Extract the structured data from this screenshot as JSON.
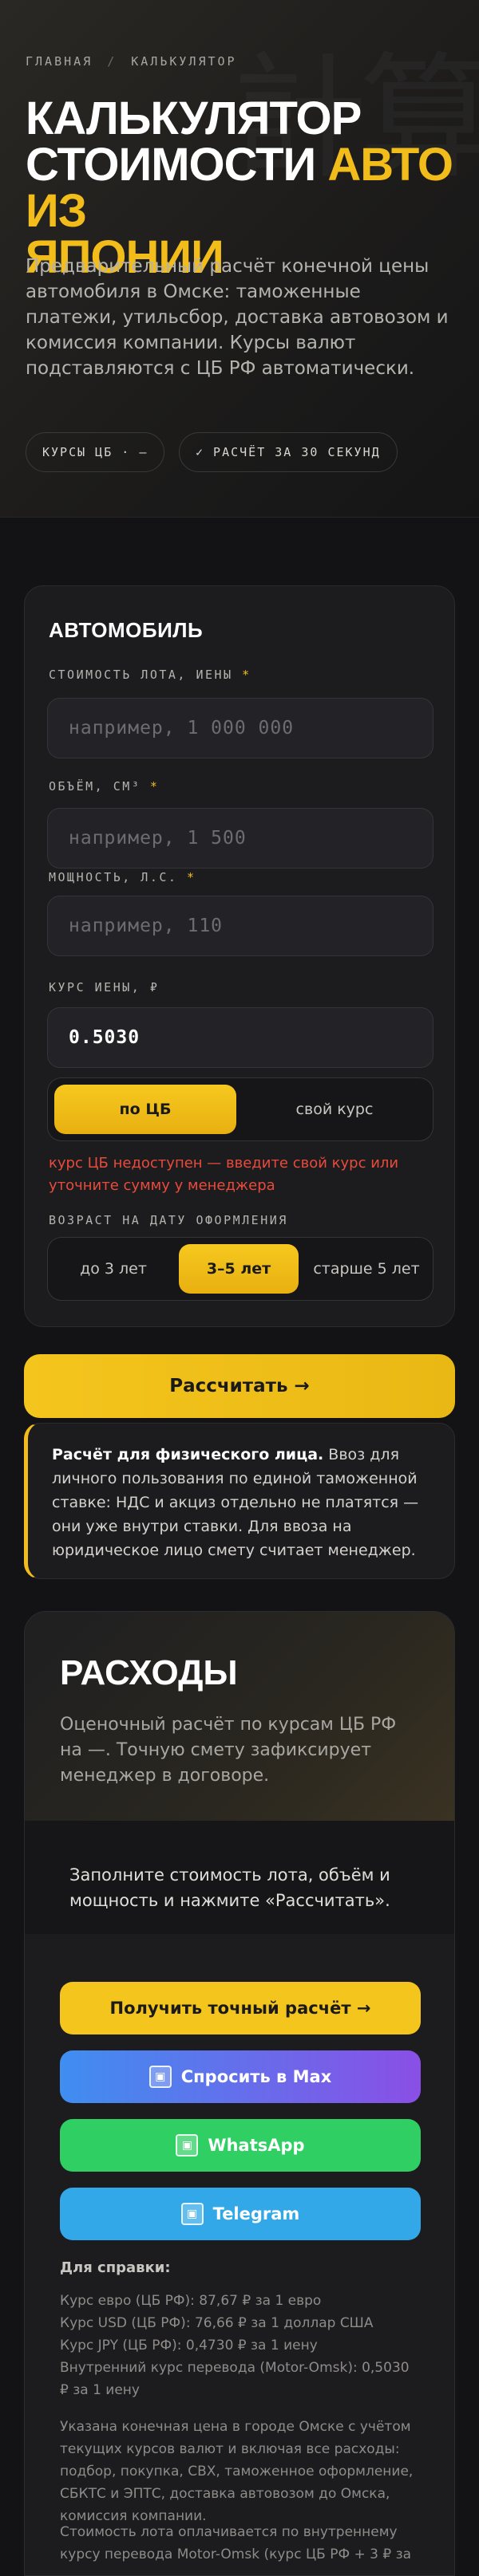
{
  "breadcrumb": {
    "home": "ГЛАВНАЯ",
    "separator": "/",
    "current": "КАЛЬКУЛЯТОР"
  },
  "hero": {
    "title_line1": "КАЛЬКУЛЯТОР",
    "title_line2_plain": "СТОИМОСТИ ",
    "title_line2_accent": "АВТО ИЗ",
    "title_line3_accent": "ЯПОНИИ",
    "description": "Предварительный расчёт конечной цены автомобиля в Омске: таможенные платежи, утильсбор, доставка автовозом и комиссия компании. Курсы валют подставляются с ЦБ РФ автоматически.",
    "pill_rate": "КУРСЫ ЦБ · —",
    "pill_time": "✓ РАСЧЁТ ЗА 30 СЕКУНД",
    "bg_glyph": "計算"
  },
  "form": {
    "title": "АВТОМОБИЛЬ",
    "lot_label": "СТОИМОСТЬ ЛОТА, ИЕНЫ",
    "lot_placeholder": "например, 1 000 000",
    "volume_label": "ОБЪЁМ, СМ³",
    "volume_placeholder": "например, 1 500",
    "power_label": "МОЩНОСТЬ, Л.С.",
    "power_placeholder": "например, 110",
    "rate_label": "КУРС ИЕНЫ, ₽",
    "rate_value": "0.5030",
    "required_mark": "*",
    "rate_mode": {
      "options": [
        "по ЦБ",
        "свой курс"
      ],
      "selected": "по ЦБ"
    },
    "warning": "курс ЦБ недоступен — введите свой курс или уточните сумму у менеджера",
    "age_label": "ВОЗРАСТ НА ДАТУ ОФОРМЛЕНИЯ",
    "age": {
      "options": [
        "до 3 лет",
        "3–5 лет",
        "старше 5 лет"
      ],
      "selected": "3–5 лет"
    }
  },
  "calculate_button": "Рассчитать →",
  "note": {
    "bold": "Расчёт для физического лица.",
    "text": " Ввоз для личного пользования по единой таможенной ставке: НДС и акциз отдельно не платятся — они уже внутри ставки. Для ввоза на юридическое лицо смету считает менеджер."
  },
  "expenses": {
    "title": "РАСХОДЫ",
    "subtitle": "Оценочный расчёт по курсам ЦБ РФ на —. Точную смету зафиксирует менеджер в договоре.",
    "empty_state": "Заполните стоимость лота, объём и мощность и нажмите «Рассчитать».",
    "actions": {
      "exact": "Получить точный расчёт →",
      "max": "Спросить в Max",
      "whatsapp": "WhatsApp",
      "telegram": "Telegram"
    },
    "colors": {
      "exact": "#f4c51d",
      "max_from": "#3f8ef0",
      "max_to": "#8a4fe6",
      "whatsapp": "#2fcf64",
      "telegram": "#32a8e8"
    },
    "reference_title": "Для справки:",
    "reference_lines": [
      "Курс евро (ЦБ РФ): 87,67 ₽ за 1 евро",
      "Курс USD (ЦБ РФ): 76,66 ₽ за 1 доллар США",
      "Курс JPY (ЦБ РФ): 0,4730 ₽ за 1 иену",
      "Внутренний курс перевода (Motor-Omsk): 0,5030 ₽ за 1 иену"
    ],
    "reference_p1": "Указана конечная цена в городе Омске с учётом текущих курсов валют и включая все расходы: подбор, покупка, СВХ, таможенное оформление, СБКТС и ЭПТС, доставка автовозом до Омска, комиссия компании.",
    "reference_p2": "Стоимость лота оплачивается по внутреннему курсу перевода Motor-Omsk (курс ЦБ РФ + 3 ₽ за"
  },
  "accent_color": "#f2bd1a"
}
